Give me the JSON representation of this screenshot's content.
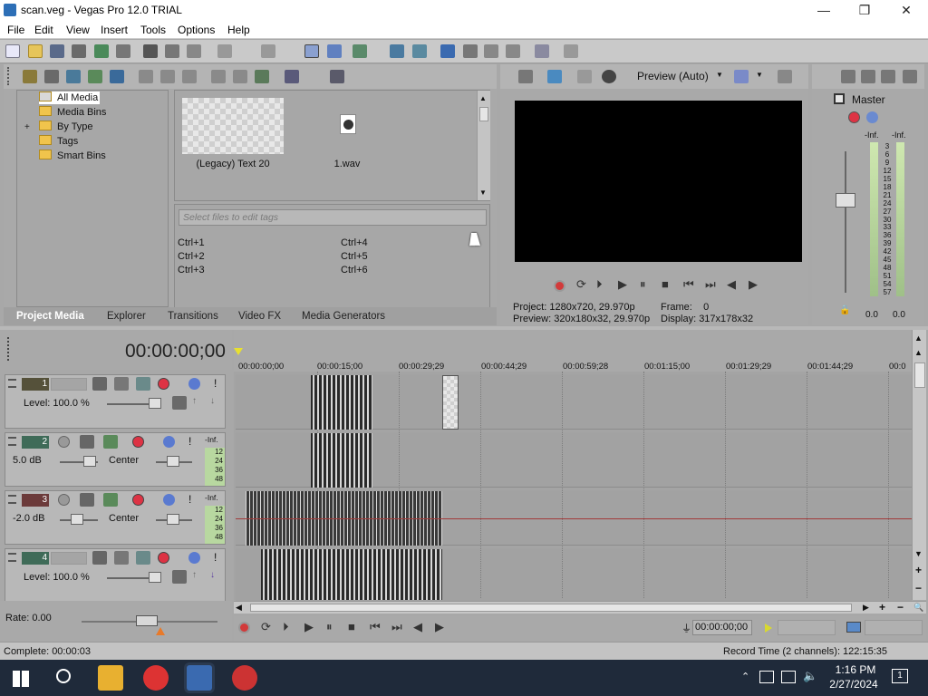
{
  "window": {
    "title": "scan.veg - Vegas Pro 12.0 TRIAL",
    "minimize": "—",
    "maximize": "❐",
    "close": "✕"
  },
  "menubar": [
    "File",
    "Edit",
    "View",
    "Insert",
    "Tools",
    "Options",
    "Help"
  ],
  "explorer": {
    "tree": [
      "All Media",
      "Media Bins",
      "By Type",
      "Tags",
      "Smart Bins"
    ],
    "expand": "+",
    "thumbs": [
      {
        "label": "(Legacy) Text 20"
      },
      {
        "label": "1.wav"
      }
    ],
    "tags_placeholder": "Select files to edit tags",
    "shortcuts": [
      "Ctrl+1",
      "Ctrl+2",
      "Ctrl+3",
      "Ctrl+4",
      "Ctrl+5",
      "Ctrl+6"
    ],
    "tabs": [
      "Project Media",
      "Explorer",
      "Transitions",
      "Video FX",
      "Media Generators"
    ]
  },
  "preview": {
    "mode": "Preview (Auto)",
    "project_label": "Project:",
    "project_value": "1280x720, 29.970p",
    "preview_label": "Preview:",
    "preview_value": "320x180x32, 29.970p",
    "frame_label": "Frame:",
    "frame_value": "0",
    "display_label": "Display:",
    "display_value": "317x178x32"
  },
  "mixer": {
    "title": "Master",
    "inf_left": "-Inf.",
    "inf_right": "-Inf.",
    "ticks": [
      "3",
      "6",
      "9",
      "12",
      "15",
      "18",
      "21",
      "24",
      "27",
      "30",
      "33",
      "36",
      "39",
      "42",
      "45",
      "48",
      "51",
      "54",
      "57"
    ],
    "val_left": "0.0",
    "val_right": "0.0"
  },
  "timeline": {
    "timecode": "00:00:00;00",
    "ruler": [
      "00:00:00;00",
      "00:00:15;00",
      "00:00:29;29",
      "00:00:44;29",
      "00:00:59;28",
      "00:01:15;00",
      "00:01:29;29",
      "00:01:44;29",
      "00:0"
    ],
    "tracks": [
      {
        "num": "1",
        "type": "video",
        "label": "Level: 100.0 %"
      },
      {
        "num": "2",
        "type": "audio",
        "vol": "5.0 dB",
        "pan": "Center",
        "inf": "-Inf.",
        "m": [
          "12",
          "24",
          "36",
          "48"
        ]
      },
      {
        "num": "3",
        "type": "audio",
        "vol": "-2.0 dB",
        "pan": "Center",
        "inf": "-Inf.",
        "m": [
          "12",
          "24",
          "36",
          "48"
        ]
      },
      {
        "num": "4",
        "type": "video",
        "label": "Level: 100.0 %"
      }
    ],
    "rate": "Rate: 0.00",
    "transport_time": "00:00:00;00"
  },
  "status": {
    "left": "Complete: 00:00:03",
    "right": "Record Time (2 channels): 122:15:35"
  },
  "taskbar": {
    "time": "1:16 PM",
    "date": "2/27/2024",
    "notif": "1"
  },
  "colors": {
    "track1": "#55513a",
    "track2": "#3f6b58",
    "track3": "#6b3a3a",
    "track4": "#3f6b58",
    "clip": "#333333",
    "wave": "#dcdcdc"
  }
}
